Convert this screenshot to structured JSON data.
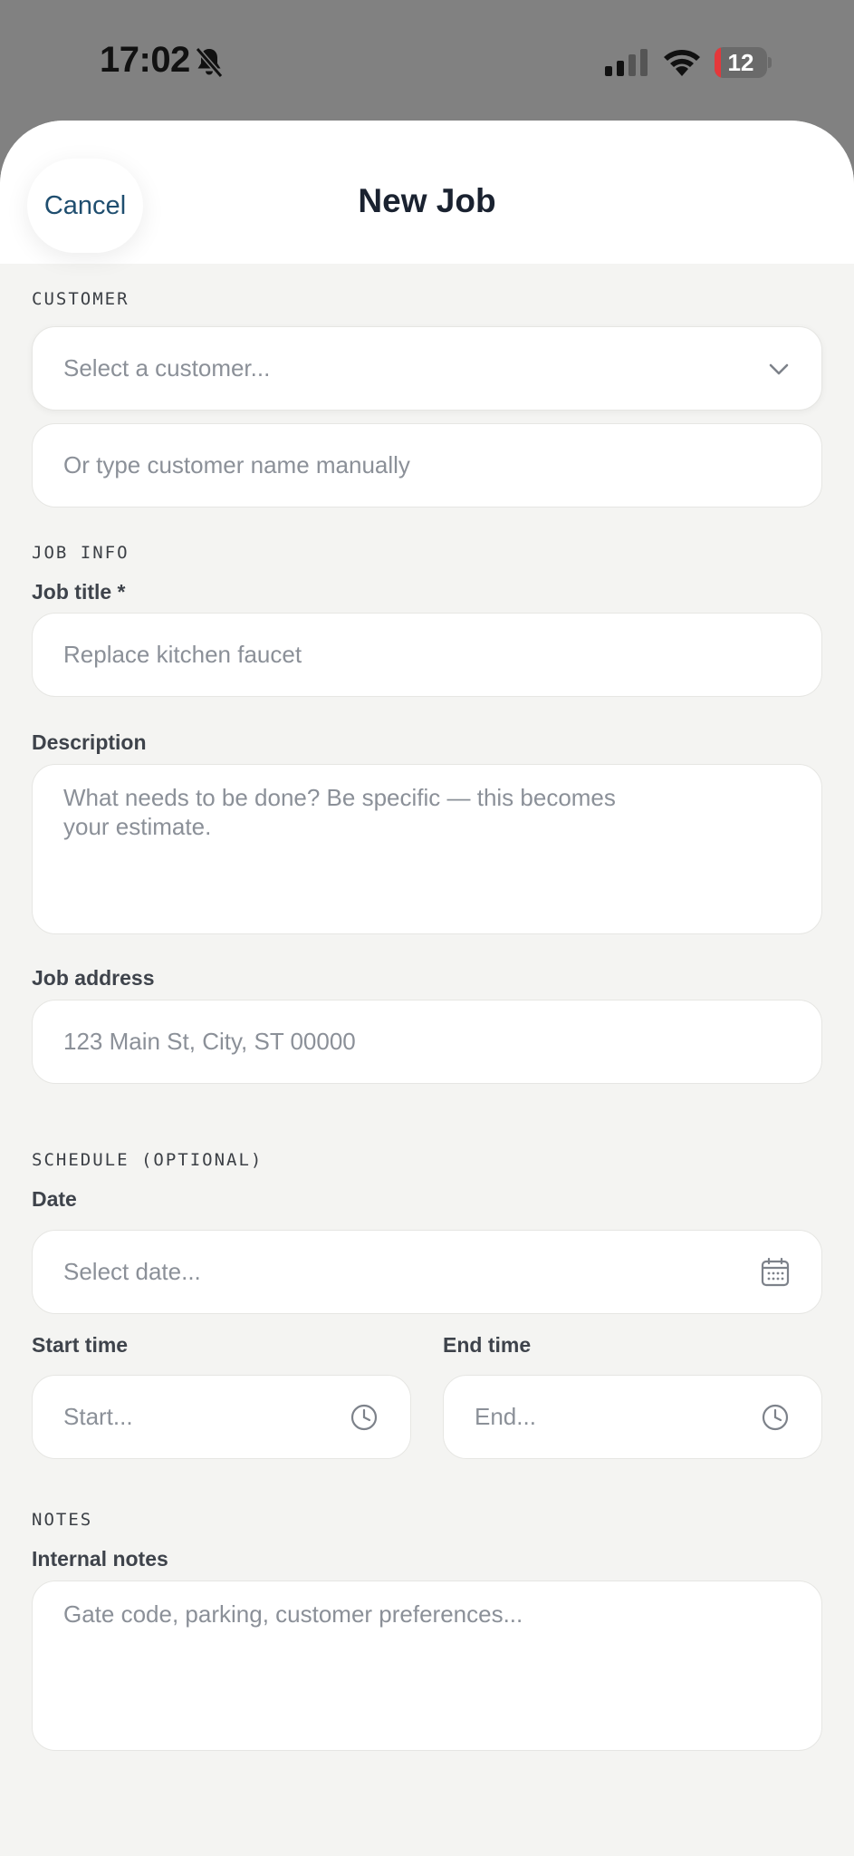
{
  "status_bar": {
    "time": "17:02",
    "battery_level": "12",
    "battery_fraction": 0.12,
    "icons": [
      "bell-slash-icon",
      "cellular-signal-icon",
      "wifi-icon",
      "battery-icon"
    ]
  },
  "header": {
    "title": "New Job",
    "cancel_label": "Cancel"
  },
  "customer": {
    "section_label": "CUSTOMER",
    "select_placeholder": "Select a customer...",
    "manual_placeholder": "Or type customer name manually"
  },
  "job_info": {
    "section_label": "JOB INFO",
    "title_label": "Job title *",
    "title_placeholder": "Replace kitchen faucet",
    "description_label": "Description",
    "description_placeholder": "What needs to be done? Be specific — this becomes your estimate.",
    "address_label": "Job address",
    "address_placeholder": "123 Main St, City, ST 00000"
  },
  "schedule": {
    "section_label": "SCHEDULE (OPTIONAL)",
    "date_label": "Date",
    "date_placeholder": "Select date...",
    "start_label": "Start time",
    "start_placeholder": "Start...",
    "end_label": "End time",
    "end_placeholder": "End..."
  },
  "notes": {
    "section_label": "NOTES",
    "internal_label": "Internal notes",
    "internal_placeholder": "Gate code, parking, customer preferences..."
  },
  "colors": {
    "backdrop": "#818181",
    "sheet_background": "#f4f4f2",
    "accent": "#1f4e6f",
    "placeholder": "#8b9098",
    "battery_low": "#e5383b"
  }
}
